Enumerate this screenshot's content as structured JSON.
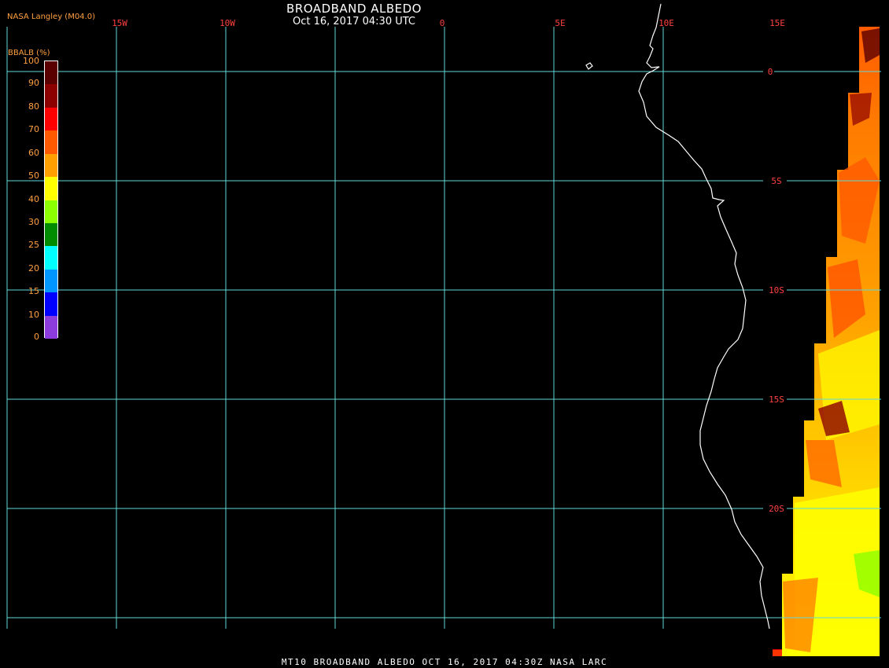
{
  "header": {
    "title": "BROADBAND ALBEDO",
    "subtitle": "Oct 16, 2017 04:30 UTC",
    "credit": "NASA Langley (M04.0)"
  },
  "footer": {
    "text": "MT10  BROADBAND ALBEDO   OCT 16, 2017 04:30Z   NASA LARC"
  },
  "colorbar": {
    "title": "BBALB (%)",
    "ticks": [
      "100",
      "90",
      "80",
      "70",
      "60",
      "50",
      "40",
      "30",
      "25",
      "20",
      "15",
      "10",
      "0"
    ],
    "segments": [
      "#5a0000",
      "#8c0000",
      "#ff0000",
      "#ff5a00",
      "#ffa000",
      "#ffff00",
      "#8cff00",
      "#008c00",
      "#00ffff",
      "#0096ff",
      "#0000ff",
      "#8c3cdc"
    ]
  },
  "map": {
    "longitude_labels": [
      "15W",
      "10W",
      "0",
      "5E",
      "10E",
      "15E"
    ],
    "latitude_labels": [
      "0",
      "5S",
      "10S",
      "15S",
      "20S"
    ],
    "colors": {
      "grid": "#5fd8d8",
      "label_text": "#ff4040",
      "coastline": "#ffffff",
      "title_text": "#ffffff",
      "credit_text": "#ffa040"
    }
  }
}
